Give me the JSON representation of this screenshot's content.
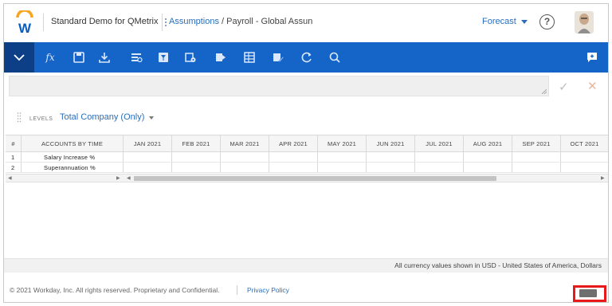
{
  "header": {
    "app_title": "Standard Demo for QMetrix",
    "breadcrumb": {
      "link": "Assumptions",
      "separator": " / ",
      "current": "Payroll - Global Assun"
    },
    "scenario": "Forecast",
    "help_label": "?"
  },
  "toolbar": {
    "icons": [
      "collapse-chevron-icon",
      "fx-icon",
      "save-icon",
      "download-icon",
      "insert-rows-icon",
      "filter-icon",
      "settings-icon",
      "export-icon",
      "table-icon",
      "edit-icon",
      "refresh-icon",
      "search-icon",
      "comment-icon"
    ],
    "fx_label": "fx"
  },
  "formula_bar": {
    "value": "",
    "confirm_label": "✓",
    "cancel_label": "✕"
  },
  "levels": {
    "label": "LEVELS",
    "value": "Total Company (Only)"
  },
  "grid": {
    "headers": [
      "#",
      "ACCOUNTS BY TIME",
      "JAN 2021",
      "FEB 2021",
      "MAR 2021",
      "APR 2021",
      "MAY 2021",
      "JUN 2021",
      "JUL 2021",
      "AUG 2021",
      "SEP 2021",
      "OCT 2021"
    ],
    "rows": [
      {
        "num": "1",
        "account": "Salary Increase %"
      },
      {
        "num": "2",
        "account": "Superannuation %"
      }
    ]
  },
  "footer": {
    "currency_note": "All currency values shown in USD - United States of America, Dollars",
    "copyright": "© 2021 Workday, Inc. All rights reserved. Proprietary and Confidential.",
    "privacy": "Privacy Policy"
  },
  "colors": {
    "toolbar": "#1565c8",
    "collapse_button": "#0d3f86",
    "link": "#2a6ebb",
    "highlight": "#e8191a"
  }
}
